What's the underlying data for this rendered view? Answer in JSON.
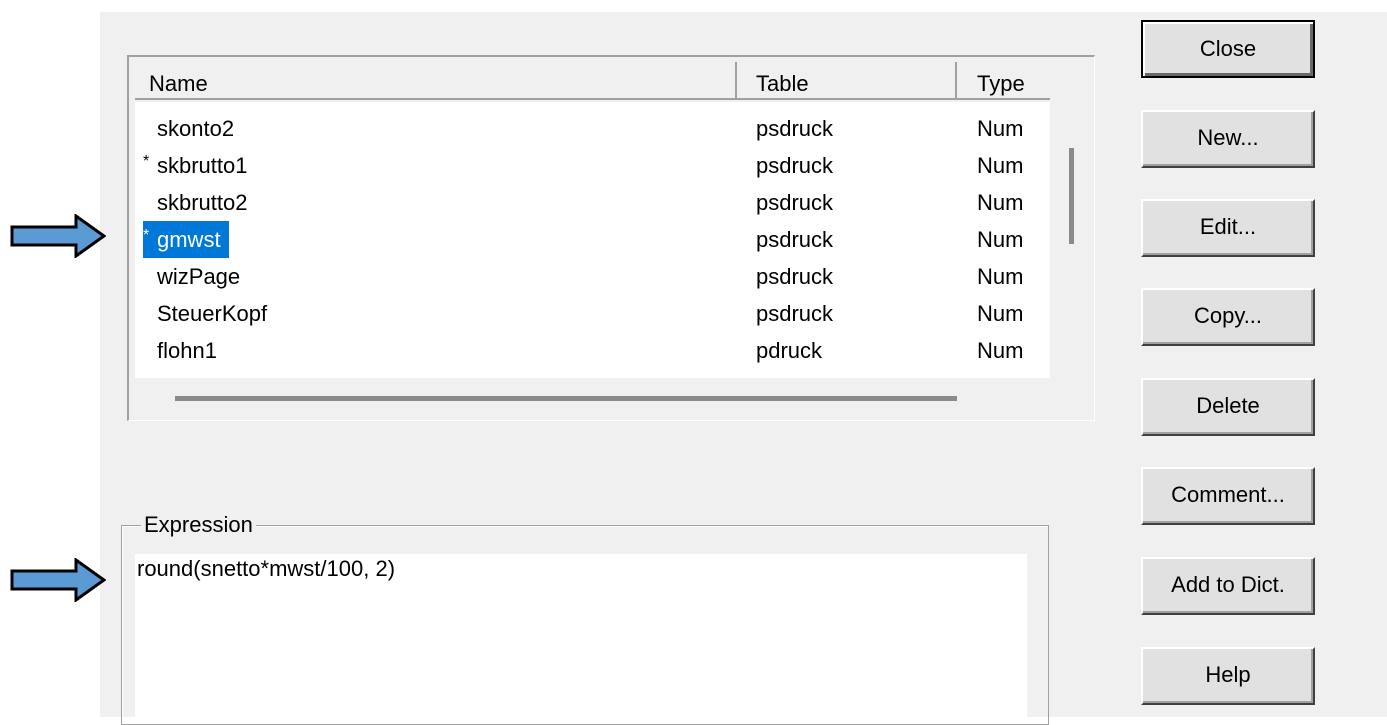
{
  "list": {
    "columns": {
      "name": "Name",
      "table": "Table",
      "type": "Type"
    },
    "rows": [
      {
        "mark": "",
        "name": "skonto2",
        "table": "psdruck",
        "type": "Num"
      },
      {
        "mark": "*",
        "name": "skbrutto1",
        "table": "psdruck",
        "type": "Num"
      },
      {
        "mark": "",
        "name": "skbrutto2",
        "table": "psdruck",
        "type": "Num"
      },
      {
        "mark": "*",
        "name": "gmwst",
        "table": "psdruck",
        "type": "Num",
        "selected": true
      },
      {
        "mark": "",
        "name": "wizPage",
        "table": "psdruck",
        "type": "Num"
      },
      {
        "mark": "",
        "name": "SteuerKopf",
        "table": "psdruck",
        "type": "Num"
      },
      {
        "mark": "",
        "name": "flohn1",
        "table": "pdruck",
        "type": "Num"
      }
    ]
  },
  "expression": {
    "label": "Expression",
    "value": "round(snetto*mwst/100, 2)"
  },
  "buttons": {
    "close": "Close",
    "new": "New...",
    "edit": "Edit...",
    "copy": "Copy...",
    "delete": "Delete",
    "comment": "Comment...",
    "add_to_dict": "Add to Dict.",
    "help": "Help"
  },
  "colors": {
    "selection": "#0078d7",
    "arrow_fill": "#5b9bd5",
    "dialog_bg": "#f0f0f0"
  },
  "icons": [
    "right-arrow-icon",
    "right-arrow-icon"
  ]
}
